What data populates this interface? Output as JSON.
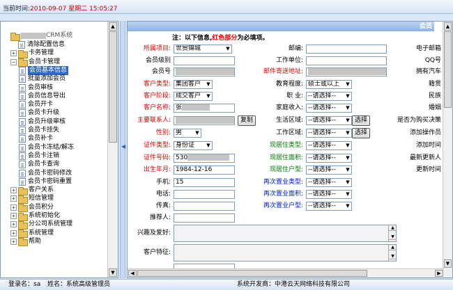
{
  "topbar": {
    "label": "当前时间:",
    "time": "2010-09-07 星期二 15:05:27"
  },
  "tree": {
    "root": "CRM系统",
    "items": [
      {
        "label": "清除配置信息",
        "kind": "leaf",
        "level": 1
      },
      {
        "label": "卡务管理",
        "kind": "folder",
        "level": 1,
        "expanded": false
      },
      {
        "label": "会员卡管理",
        "kind": "folder",
        "level": 1,
        "expanded": true
      },
      {
        "label": "会员基本信息",
        "kind": "leaf",
        "level": 2,
        "selected": true
      },
      {
        "label": "批量添加会员",
        "kind": "leaf",
        "level": 2
      },
      {
        "label": "会员审核",
        "kind": "leaf",
        "level": 2
      },
      {
        "label": "会员信息导出",
        "kind": "leaf",
        "level": 2
      },
      {
        "label": "会员开卡",
        "kind": "leaf",
        "level": 2
      },
      {
        "label": "会员卡升级",
        "kind": "leaf",
        "level": 2
      },
      {
        "label": "会员升级审核",
        "kind": "leaf",
        "level": 2
      },
      {
        "label": "会员卡挂失",
        "kind": "leaf",
        "level": 2
      },
      {
        "label": "会员补卡",
        "kind": "leaf",
        "level": 2
      },
      {
        "label": "会员卡冻结/解冻",
        "kind": "leaf",
        "level": 2
      },
      {
        "label": "会员卡注销",
        "kind": "leaf",
        "level": 2
      },
      {
        "label": "会员卡查询",
        "kind": "leaf",
        "level": 2
      },
      {
        "label": "会员卡密码修改",
        "kind": "leaf",
        "level": 2
      },
      {
        "label": "会员卡密码重置",
        "kind": "leaf",
        "level": 2
      },
      {
        "label": "客户关系",
        "kind": "folder",
        "level": 1
      },
      {
        "label": "短信管理",
        "kind": "folder",
        "level": 1
      },
      {
        "label": "会员积分",
        "kind": "folder",
        "level": 1
      },
      {
        "label": "系统初始化",
        "kind": "folder",
        "level": 1
      },
      {
        "label": "分公司系统管理",
        "kind": "folder",
        "level": 1
      },
      {
        "label": "系统管理",
        "kind": "folder",
        "level": 1
      },
      {
        "label": "帮助",
        "kind": "folder",
        "level": 1
      }
    ]
  },
  "form": {
    "header": "会员",
    "note_prefix": "注：以下信息,",
    "note_red": "红色部分",
    "note_suffix": "为必填项。",
    "labels": {
      "belong_project": "所属项目:",
      "member_level": "会员级别",
      "member_no": "会员号",
      "customer_type": "客户类型:",
      "customer_stage": "客户阶段:",
      "customer_name": "客户名称:",
      "main_contact": "主要联系人:",
      "gender": "性别:",
      "id_type": "证件类型:",
      "id_no": "证件号码:",
      "birth_date": "出生年月:",
      "mobile": "手机:",
      "phone": "电话:",
      "fax": "传真:",
      "referrer": "推荐人:",
      "hobbies": "兴趣及爱好:",
      "features": "客户特征:",
      "postcode": "邮编:",
      "work_unit": "工作单位:",
      "mail_address": "邮件寄送地址:",
      "education": "教育程度:",
      "job": "职  业:",
      "family_income": "家庭收入:",
      "life_area": "生活区域:",
      "work_area": "工作区域:",
      "cur_housing_type": "现居住类型:",
      "cur_housing_area": "现居住面积:",
      "cur_housing_type2": "现居住户型:",
      "re_buy_type": "再次置业类型:",
      "re_buy_area": "再次置业面积:",
      "re_buy_type2": "再次置业户型:",
      "email": "电子邮箱",
      "qq": "QQ号",
      "own_car": "拥有汽车",
      "origin": "籍贯",
      "ethnic": "民族",
      "marital": "婚姻",
      "buy_house": "是否为购买决策",
      "add_operator": "添加操作员",
      "add_time": "添加时间",
      "last_update": "最新更新人",
      "update_time": "更新时间"
    },
    "values": {
      "belong_project": "世贸锦城",
      "customer_type": "集团客户",
      "customer_stage": "成交客户",
      "customer_name": "张",
      "gender": "男",
      "id_type": "身份证",
      "id_no": "530",
      "birth_date": "1984-12-16",
      "mobile": "15",
      "education": "硕士或以上",
      "please_select": "--请选择--"
    },
    "buttons": {
      "copy": "复制",
      "choose": "选择"
    }
  },
  "status": {
    "login": "登录名：sa",
    "name": "姓名：系统高级管理员",
    "developer": "系统开发商：中港云天网络科技有限公司"
  }
}
